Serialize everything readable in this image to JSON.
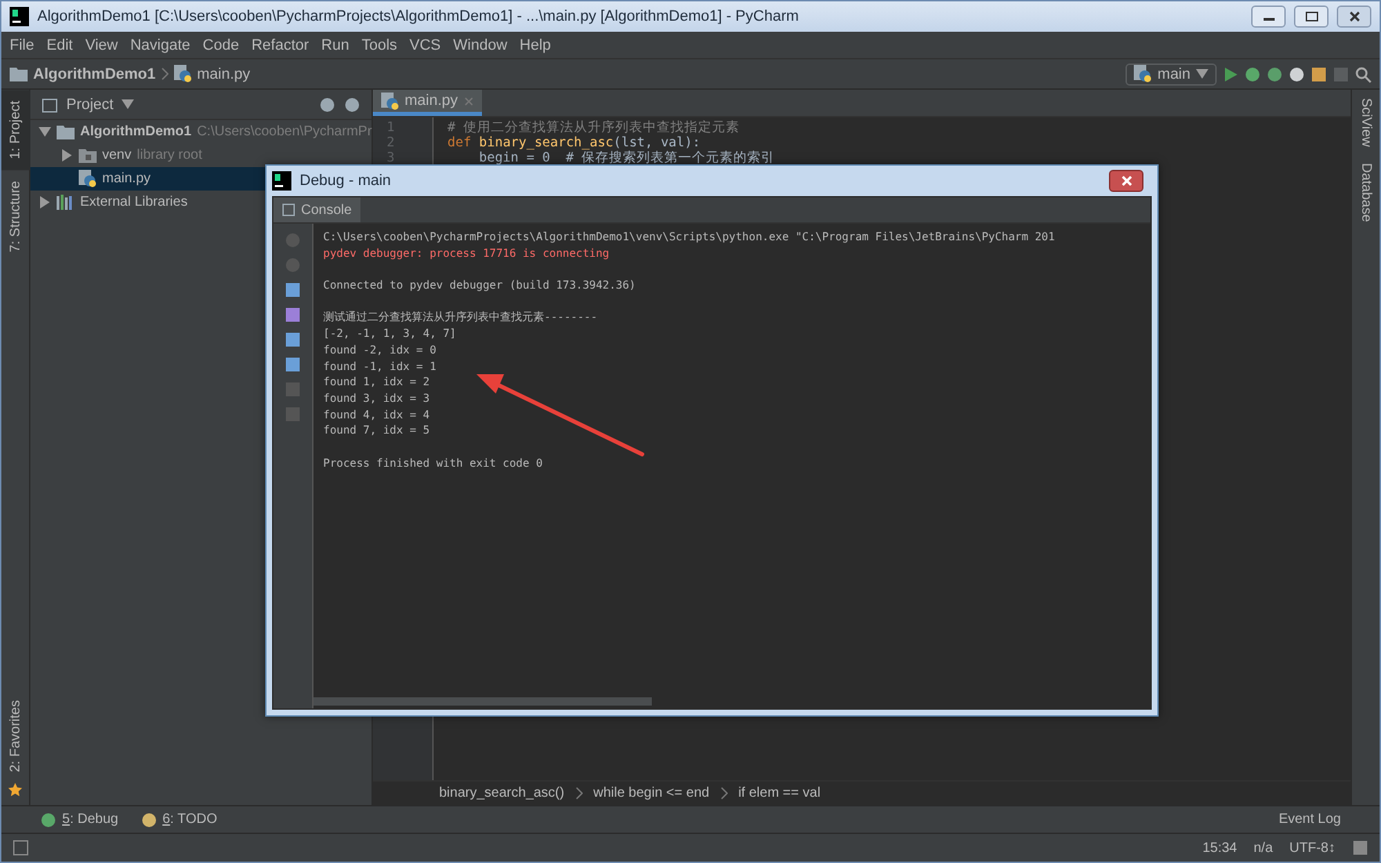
{
  "window": {
    "title": "AlgorithmDemo1 [C:\\Users\\cooben\\PycharmProjects\\AlgorithmDemo1] - ...\\main.py [AlgorithmDemo1] - PyCharm"
  },
  "menu": [
    "File",
    "Edit",
    "View",
    "Navigate",
    "Code",
    "Refactor",
    "Run",
    "Tools",
    "VCS",
    "Window",
    "Help"
  ],
  "navbar": {
    "crumbs": [
      "AlgorithmDemo1",
      "main.py"
    ],
    "run_config": "main"
  },
  "left_stripe": [
    {
      "label": "1: Project",
      "selected": true
    },
    {
      "label": "7: Structure",
      "selected": false
    }
  ],
  "favorites": "2: Favorites",
  "project": {
    "title": "Project",
    "tree": [
      {
        "name": "AlgorithmDemo1",
        "hint": "C:\\Users\\cooben\\PycharmPr",
        "kind": "folder",
        "expanded": true,
        "selected": false,
        "children": [
          {
            "name": "venv",
            "hint": "library root",
            "kind": "venv",
            "expanded": false,
            "selected": false
          },
          {
            "name": "main.py",
            "kind": "file",
            "selected": true
          }
        ]
      },
      {
        "name": "External Libraries",
        "kind": "libs",
        "expanded": false,
        "selected": false
      }
    ]
  },
  "editor": {
    "tab": "main.py",
    "lines": [
      {
        "num": "1",
        "kind": "comment",
        "text": "# 使用二分查找算法从升序列表中查找指定元素"
      },
      {
        "num": "2",
        "kind": "def",
        "keyword": "def",
        "name": "binary_search_asc",
        "rest": "(lst, val):"
      },
      {
        "num": "3",
        "kind": "code",
        "text": "    begin = 0  # 保存搜索列表第一个元素的索引"
      }
    ],
    "breadcrumbs": [
      "binary_search_asc()",
      "while begin <= end",
      "if elem == val"
    ]
  },
  "right_stripe": [
    "SciView",
    "Database"
  ],
  "debug_dialog": {
    "title": "Debug - main",
    "tab": "Console",
    "output": [
      {
        "text": "C:\\Users\\cooben\\PycharmProjects\\AlgorithmDemo1\\venv\\Scripts\\python.exe \"C:\\Program Files\\JetBrains\\PyCharm 201",
        "kind": "normal"
      },
      {
        "text": "pydev debugger: process 17716 is connecting",
        "kind": "error"
      },
      {
        "kind": "blank"
      },
      {
        "text": "Connected to pydev debugger (build 173.3942.36)",
        "kind": "normal"
      },
      {
        "kind": "blank"
      },
      {
        "text": "测试通过二分查找算法从升序列表中查找元素--------",
        "kind": "normal"
      },
      {
        "text": "[-2, -1, 1, 3, 4, 7]",
        "kind": "normal"
      },
      {
        "text": "found -2, idx = 0",
        "kind": "normal"
      },
      {
        "text": "found -1, idx = 1",
        "kind": "normal"
      },
      {
        "text": "found 1, idx = 2",
        "kind": "normal"
      },
      {
        "text": "found 3, idx = 3",
        "kind": "normal"
      },
      {
        "text": "found 4, idx = 4",
        "kind": "normal"
      },
      {
        "text": "found 7, idx = 5",
        "kind": "normal"
      },
      {
        "kind": "blank"
      },
      {
        "text": "Process finished with exit code 0",
        "kind": "normal"
      }
    ]
  },
  "bottom_tools": [
    {
      "key": "5",
      "label": ": Debug"
    },
    {
      "key": "6",
      "label": ": TODO"
    }
  ],
  "event_log": "Event Log",
  "status_bar": {
    "position": "15:34",
    "separator": "n/a",
    "encoding": "UTF-8↕"
  }
}
